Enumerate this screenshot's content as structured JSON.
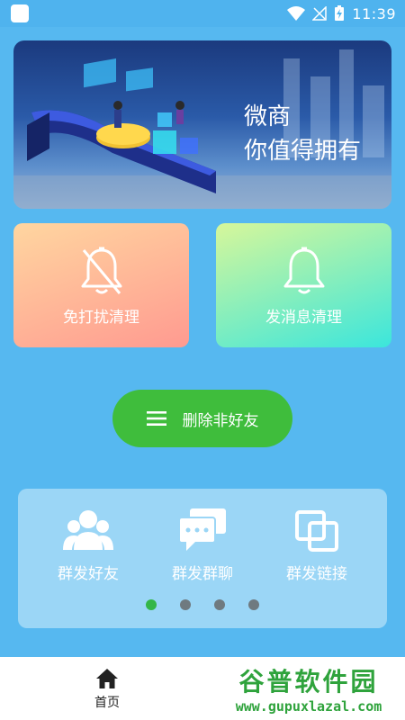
{
  "status_bar": {
    "time": "11:39"
  },
  "banner": {
    "line1": "微商",
    "line2": "你值得拥有"
  },
  "cards": [
    {
      "label": "免打扰清理",
      "icon": "bell-off-icon"
    },
    {
      "label": "发消息清理",
      "icon": "bell-icon"
    }
  ],
  "delete_button": {
    "label": "删除非好友",
    "icon": "menu-icon"
  },
  "features": [
    {
      "label": "群发好友",
      "icon": "group-icon"
    },
    {
      "label": "群发群聊",
      "icon": "chat-bubbles-icon"
    },
    {
      "label": "群发链接",
      "icon": "link-icon"
    }
  ],
  "pagination": {
    "count": 4,
    "active": 0
  },
  "tabbar": {
    "home_label": "首页"
  },
  "watermark": {
    "title": "谷普软件园",
    "url": "www.gupuxlazal.com"
  },
  "colors": {
    "background": "#56b8f0",
    "accent_green": "#3fbd3c",
    "panel": "#9bd6f6"
  }
}
